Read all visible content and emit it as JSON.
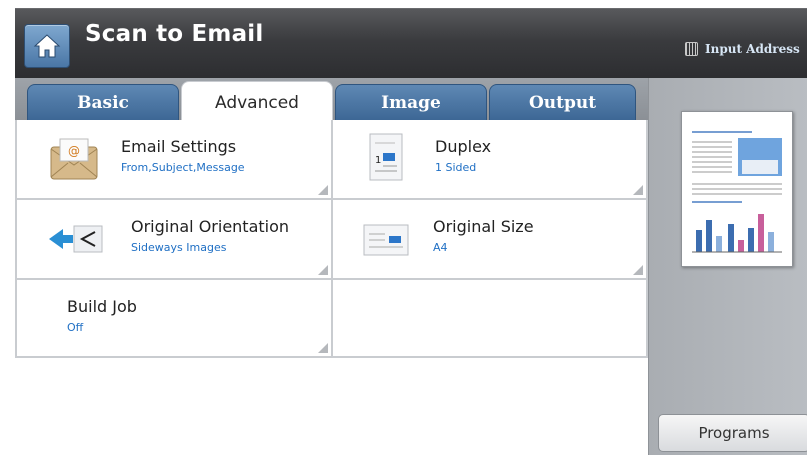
{
  "header": {
    "title": "Scan to Email",
    "input_address_label": "Input Address"
  },
  "tabs": [
    {
      "label": "Basic"
    },
    {
      "label": "Advanced"
    },
    {
      "label": "Image"
    },
    {
      "label": "Output"
    }
  ],
  "active_tab": "Advanced",
  "settings": {
    "email_settings": {
      "label": "Email Settings",
      "value": "From,Subject,Message"
    },
    "duplex": {
      "label": "Duplex",
      "value": "1 Sided"
    },
    "original_orientation": {
      "label": "Original Orientation",
      "value": "Sideways Images"
    },
    "original_size": {
      "label": "Original Size",
      "value": "A4"
    },
    "build_job": {
      "label": "Build Job",
      "value": "Off"
    }
  },
  "right_panel": {
    "programs_label": "Programs"
  },
  "colors": {
    "accent_blue": "#1f6fc4",
    "tab_blue": "#4a76a6",
    "header_dark": "#3a3b3e"
  },
  "icons": {
    "home": "home-icon",
    "keyboard": "keyboard-icon",
    "email": "envelope-icon",
    "duplex": "document-icon",
    "orientation": "orientation-icon",
    "size": "document-size-icon"
  }
}
